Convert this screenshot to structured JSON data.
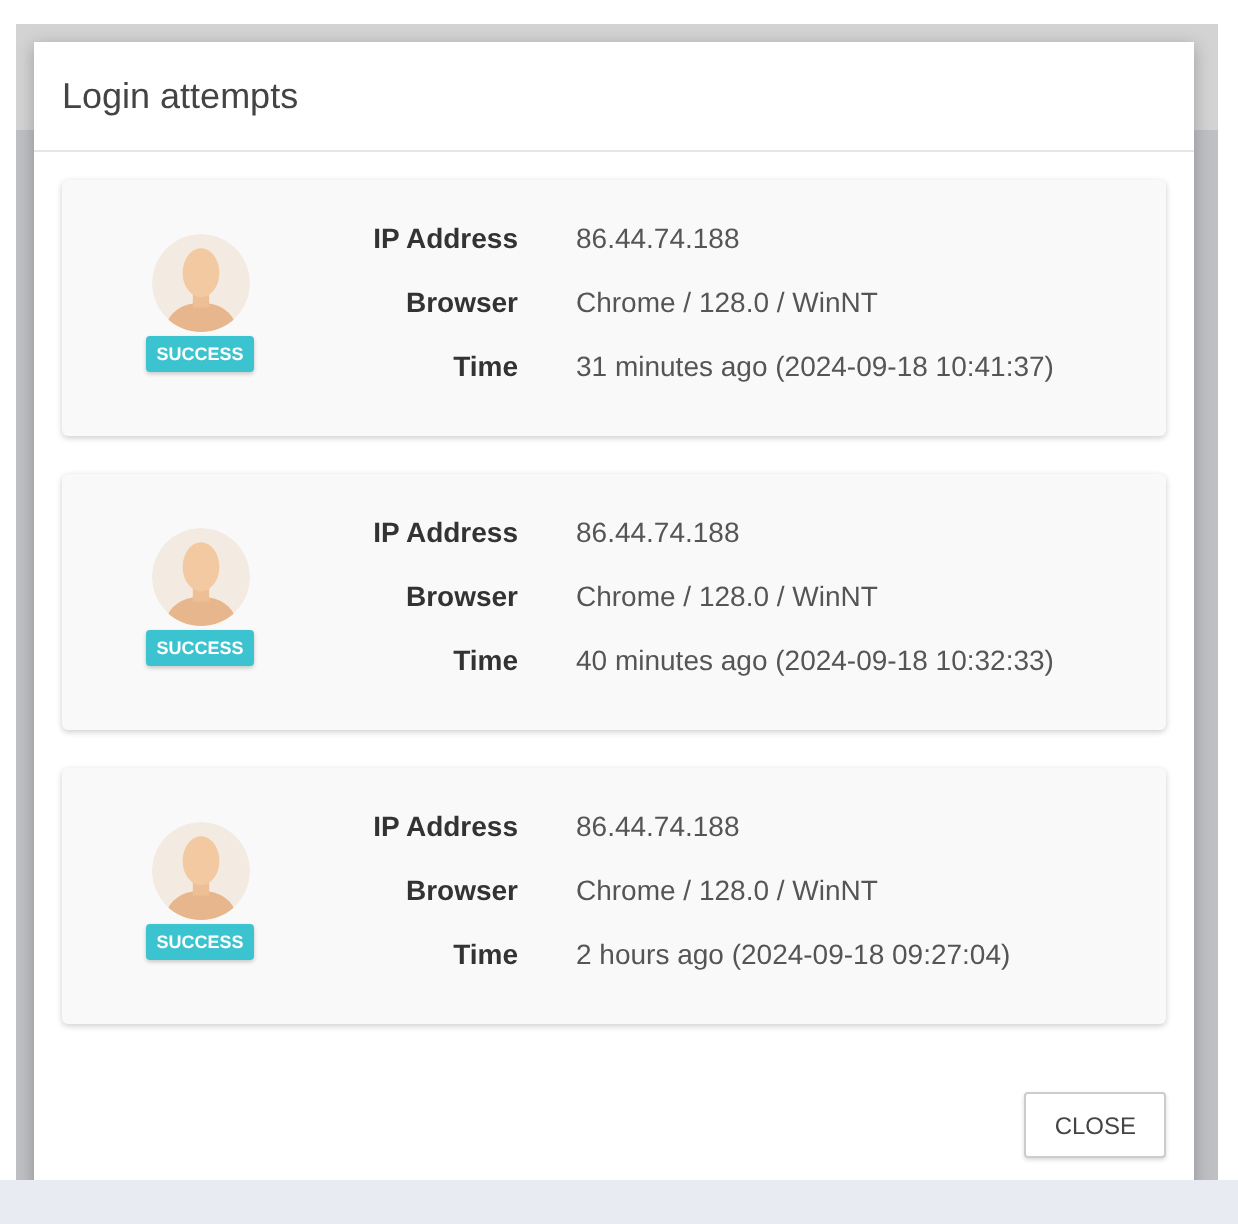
{
  "dialog": {
    "title": "Login attempts",
    "attempts": [
      {
        "status": "SUCCESS",
        "fields": [
          {
            "label": "IP Address",
            "value": "86.44.74.188"
          },
          {
            "label": "Browser",
            "value": "Chrome / 128.0 / WinNT"
          },
          {
            "label": "Time",
            "value": "31 minutes ago (2024-09-18 10:41:37)"
          }
        ]
      },
      {
        "status": "SUCCESS",
        "fields": [
          {
            "label": "IP Address",
            "value": "86.44.74.188"
          },
          {
            "label": "Browser",
            "value": "Chrome / 128.0 / WinNT"
          },
          {
            "label": "Time",
            "value": "40 minutes ago (2024-09-18 10:32:33)"
          }
        ]
      },
      {
        "status": "SUCCESS",
        "fields": [
          {
            "label": "IP Address",
            "value": "86.44.74.188"
          },
          {
            "label": "Browser",
            "value": "Chrome / 128.0 / WinNT"
          },
          {
            "label": "Time",
            "value": "2 hours ago (2024-09-18 09:27:04)"
          }
        ]
      }
    ],
    "buttons": [
      "CLOSE"
    ]
  }
}
